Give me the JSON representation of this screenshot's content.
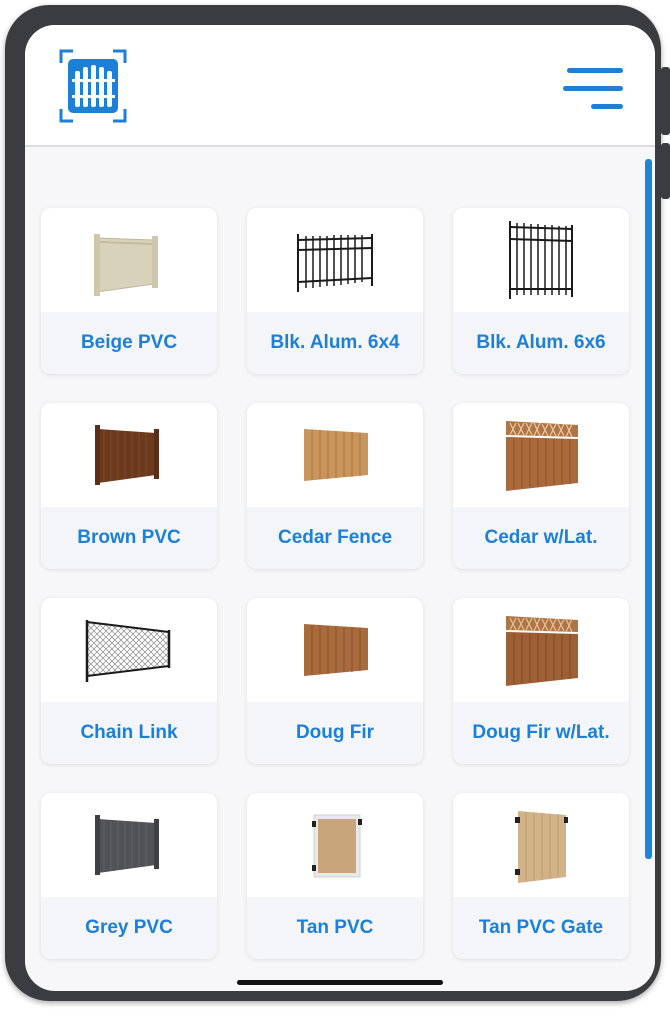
{
  "app": {
    "brand_icon": "fence-logo-icon",
    "menu_icon": "hamburger-menu-icon",
    "accent": "#1c7fd8"
  },
  "fences": [
    {
      "label": "Beige PVC",
      "icon": "beige-pvc-fence-icon"
    },
    {
      "label": "Blk. Alum. 6x4",
      "icon": "black-aluminum-fence-icon"
    },
    {
      "label": "Blk. Alum. 6x6",
      "icon": "black-aluminum-tall-fence-icon"
    },
    {
      "label": "Brown PVC",
      "icon": "brown-pvc-fence-icon"
    },
    {
      "label": "Cedar Fence",
      "icon": "cedar-fence-icon"
    },
    {
      "label": "Cedar w/Lat.",
      "icon": "cedar-lattice-fence-icon"
    },
    {
      "label": "Chain Link",
      "icon": "chain-link-fence-icon"
    },
    {
      "label": "Doug Fir",
      "icon": "doug-fir-fence-icon"
    },
    {
      "label": "Doug Fir w/Lat.",
      "icon": "doug-fir-lattice-fence-icon"
    },
    {
      "label": "Grey PVC",
      "icon": "grey-pvc-fence-icon"
    },
    {
      "label": "Tan PVC",
      "icon": "tan-pvc-fence-icon"
    },
    {
      "label": "Tan PVC Gate",
      "icon": "tan-pvc-gate-icon"
    }
  ]
}
